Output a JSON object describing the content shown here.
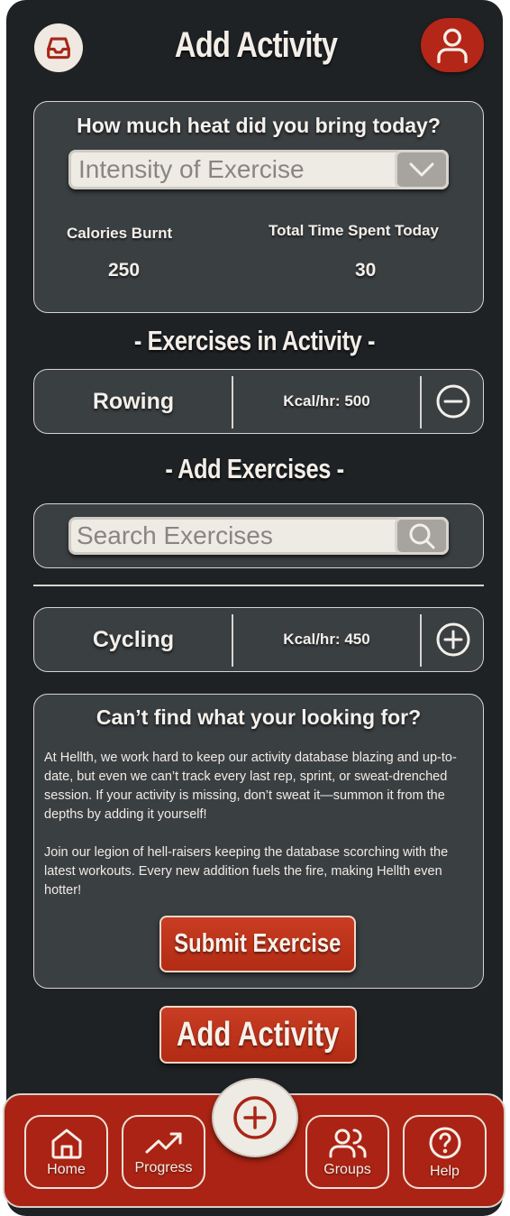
{
  "header": {
    "title": "Add Activity",
    "inbox_icon": "inbox-icon",
    "profile_icon": "user-icon"
  },
  "heat_card": {
    "question": "How much heat did you bring today?",
    "intensity_placeholder": "Intensity of Exercise",
    "calories_label": "Calories Burnt",
    "calories_value": "250",
    "time_label": "Total Time Spent Today",
    "time_value": "30"
  },
  "exercises_in_activity": {
    "title": "- Exercises in Activity -",
    "items": [
      {
        "name": "Rowing",
        "kcal": "Kcal/hr: 500",
        "action_icon": "minus-circle-icon"
      }
    ]
  },
  "add_exercises": {
    "title": "- Add Exercises -",
    "search_placeholder": "Search Exercises",
    "results": [
      {
        "name": "Cycling",
        "kcal": "Kcal/hr: 450",
        "action_icon": "plus-circle-icon"
      }
    ]
  },
  "help_card": {
    "title": "Can’t find what your looking for?",
    "paragraph_1": "At Hellth, we work hard to keep our activity database blazing and up-to-date, but even we can’t track every last rep, sprint, or sweat-drenched session. If your activity is missing, don’t sweat it—summon it from the depths by adding it yourself!",
    "paragraph_2": "Join our legion of hell-raisers keeping the database scorching with the latest workouts. Every new addition fuels the fire, making Hellth even hotter!",
    "submit_label": "Submit Exercise"
  },
  "add_activity_label": "Add Activity",
  "nav": {
    "items": [
      {
        "label": "Home",
        "icon": "home-icon"
      },
      {
        "label": "Progress",
        "icon": "trending-up-icon"
      },
      {
        "label": "Groups",
        "icon": "users-icon"
      },
      {
        "label": "Help",
        "icon": "help-circle-icon"
      }
    ],
    "center_icon": "plus-circle-icon"
  },
  "colors": {
    "background": "#1f2225",
    "card": "#3a3f42",
    "accent_red": "#b42618",
    "cream": "#eeeae4"
  }
}
